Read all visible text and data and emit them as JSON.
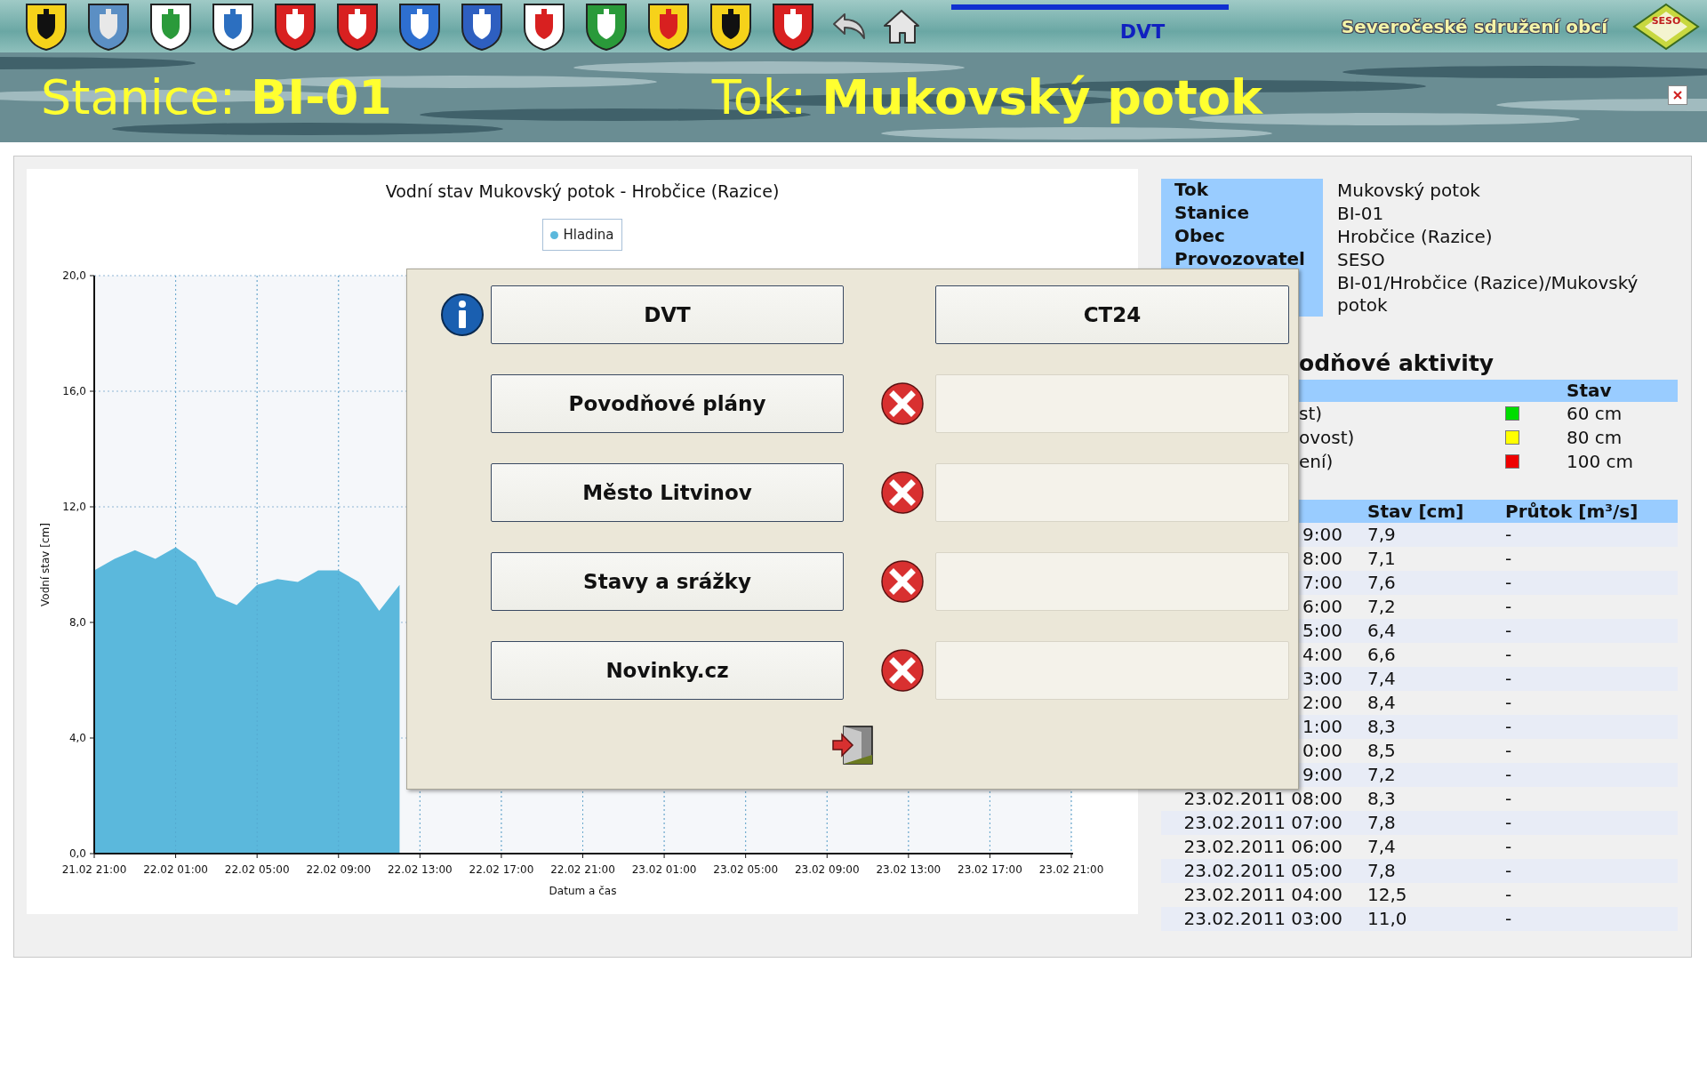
{
  "header": {
    "nav_title": "DVT",
    "org_name": "Severočeské sdružení obcí",
    "logo_text": "SESO"
  },
  "banner": {
    "station_label": "Stanice:",
    "station": "BI-01",
    "river_label": "Tok:",
    "river": "Mukovský potok"
  },
  "chart": {
    "chart_data": {
      "type": "area",
      "title": "Vodní stav Mukovský potok - Hrobčice (Razice)",
      "xlabel": "Datum a čas",
      "ylabel": "Vodní stav [cm]",
      "categories": [
        "21.02 21:00",
        null,
        null,
        null,
        "22.02 01:00",
        null,
        null,
        null,
        "22.02 05:00",
        null,
        null,
        null,
        "22.02 09:00",
        null,
        null,
        null,
        "22.02 13:00",
        null,
        null,
        null,
        "22.02 17:00",
        null,
        null,
        null,
        "22.02 21:00",
        null,
        null,
        null,
        "23.02 01:00",
        null,
        null,
        null,
        "23.02 05:00",
        null,
        null,
        null,
        "23.02 09:00",
        null,
        null,
        null,
        "23.02 13:00",
        null,
        null,
        null,
        "23.02 17:00",
        null,
        null,
        null,
        "23.02 21:00"
      ],
      "series": [
        {
          "name": "Hladina",
          "color": "#5bb8dc",
          "values": [
            9.8,
            10.2,
            10.5,
            10.2,
            10.6,
            10.1,
            8.9,
            8.6,
            9.3,
            9.5,
            9.4,
            9.8,
            9.8,
            9.4,
            8.4,
            9.3,
            null,
            null,
            null,
            null,
            null,
            null,
            null,
            null,
            null,
            null,
            null,
            null,
            null,
            null,
            null,
            null,
            null,
            null,
            null,
            null,
            null,
            null,
            null,
            null,
            null,
            null,
            null,
            null,
            null,
            null,
            null,
            null,
            null
          ]
        }
      ],
      "ylim": [
        0,
        20
      ],
      "grid": true,
      "yticks": [
        {
          "value": 0,
          "label": "0,0"
        },
        {
          "value": 4,
          "label": "4,0"
        },
        {
          "value": 8,
          "label": "8,0"
        },
        {
          "value": 12,
          "label": "12,0"
        },
        {
          "value": 16,
          "label": "16,0"
        },
        {
          "value": 20,
          "label": "20,0"
        }
      ]
    }
  },
  "station_info": {
    "rows": [
      {
        "label": "Tok",
        "value": "Mukovský potok"
      },
      {
        "label": "Stanice",
        "value": "BI-01"
      },
      {
        "label": "Obec",
        "value": "Hrobčice (Razice)"
      },
      {
        "label": "Provozovatel",
        "value": "SESO"
      },
      {
        "value": "BI-01/Hrobčice (Razice)/Mukovský potok"
      }
    ]
  },
  "flood_levels": {
    "heading": "odňové aktivity",
    "column": "Stav",
    "rows": [
      {
        "name": "st)",
        "color": "#00dd00",
        "value": "60 cm"
      },
      {
        "name": "ovost)",
        "color": "#ffff00",
        "value": "80 cm"
      },
      {
        "name": "ení)",
        "color": "#ee0000",
        "value": "100 cm"
      }
    ]
  },
  "readings": {
    "columns": [
      "Stav [cm]",
      "Průtok [m³/s]"
    ],
    "rows": [
      {
        "time": "9:00",
        "level": "7,9",
        "flow": "-"
      },
      {
        "time": "8:00",
        "level": "7,1",
        "flow": "-"
      },
      {
        "time": "7:00",
        "level": "7,6",
        "flow": "-"
      },
      {
        "time": "6:00",
        "level": "7,2",
        "flow": "-"
      },
      {
        "time": "5:00",
        "level": "6,4",
        "flow": "-"
      },
      {
        "time": "4:00",
        "level": "6,6",
        "flow": "-"
      },
      {
        "time": "3:00",
        "level": "7,4",
        "flow": "-"
      },
      {
        "time": "2:00",
        "level": "8,4",
        "flow": "-"
      },
      {
        "time": "1:00",
        "level": "8,3",
        "flow": "-"
      },
      {
        "time": "0:00",
        "level": "8,5",
        "flow": "-"
      },
      {
        "time": "9:00",
        "level": "7,2",
        "flow": "-"
      },
      {
        "time": "23.02.2011 08:00",
        "level": "8,3",
        "flow": "-"
      },
      {
        "time": "23.02.2011 07:00",
        "level": "7,8",
        "flow": "-"
      },
      {
        "time": "23.02.2011 06:00",
        "level": "7,4",
        "flow": "-"
      },
      {
        "time": "23.02.2011 05:00",
        "level": "7,8",
        "flow": "-"
      },
      {
        "time": "23.02.2011 04:00",
        "level": "12,5",
        "flow": "-"
      },
      {
        "time": "23.02.2011 03:00",
        "level": "11,0",
        "flow": "-"
      }
    ]
  },
  "dialog": {
    "rows": [
      {
        "kind": "info",
        "label": "DVT",
        "link": "CT24"
      },
      {
        "kind": "error",
        "label": "Povodňové plány"
      },
      {
        "kind": "error",
        "label": "Město Litvinov"
      },
      {
        "kind": "error",
        "label": "Stavy a srážky"
      },
      {
        "kind": "error",
        "label": "Novinky.cz"
      }
    ]
  }
}
